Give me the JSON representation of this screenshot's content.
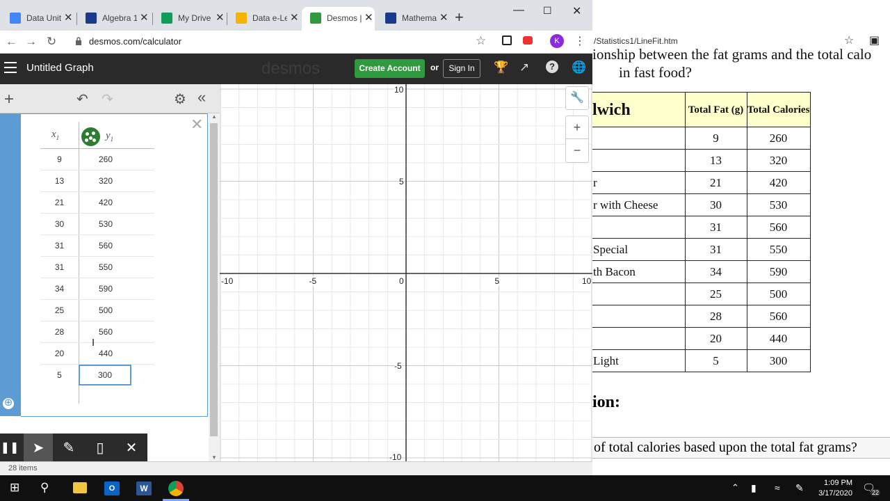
{
  "chrome": {
    "tabs": [
      {
        "label": "Data Unit",
        "color": "#4285f4"
      },
      {
        "label": "Algebra 1",
        "color": "#1b3a8c"
      },
      {
        "label": "My Drive",
        "color": "#0f9d58"
      },
      {
        "label": "Data e-Le",
        "color": "#f4b400"
      },
      {
        "label": "Desmos |",
        "color": "#2f9a3e"
      },
      {
        "label": "Mathema",
        "color": "#1b3a8c"
      }
    ],
    "url": "desmos.com/calculator",
    "avatar_letter": "K"
  },
  "desmos": {
    "graph_title": "Untitled Graph",
    "logo": "desmos",
    "create_account": "Create Account",
    "or": "or",
    "sign_in": "Sign In",
    "table": {
      "x_header": "x",
      "x_sub": "1",
      "y_header": "y",
      "y_sub": "1",
      "x": [
        "9",
        "13",
        "21",
        "30",
        "31",
        "31",
        "34",
        "25",
        "28",
        "20",
        "5"
      ],
      "y": [
        "260",
        "320",
        "420",
        "530",
        "560",
        "550",
        "590",
        "500",
        "560",
        "440",
        "300"
      ]
    },
    "axis": {
      "x_ticks": [
        "-10",
        "-5",
        "0",
        "5",
        "10"
      ],
      "y_ticks": [
        "10",
        "5",
        "-5",
        "-10"
      ]
    }
  },
  "status_text": "28 items",
  "background_doc": {
    "url": "/Statistics1/LineFit.htm",
    "question_line1": "ionship between the fat grams and the total calo",
    "question_line2": "in fast food?",
    "headers": {
      "name": "lwich",
      "fat": "Total Fat (g)",
      "cal": "Total Calories"
    },
    "rows": [
      {
        "name": "",
        "fat": "9",
        "cal": "260"
      },
      {
        "name": "",
        "fat": "13",
        "cal": "320"
      },
      {
        "name": "r",
        "fat": "21",
        "cal": "420"
      },
      {
        "name": "r with Cheese",
        "fat": "30",
        "cal": "530"
      },
      {
        "name": "",
        "fat": "31",
        "cal": "560"
      },
      {
        "name": "Special",
        "fat": "31",
        "cal": "550"
      },
      {
        "name": "th Bacon",
        "fat": "34",
        "cal": "590"
      },
      {
        "name": "",
        "fat": "25",
        "cal": "500"
      },
      {
        "name": "",
        "fat": "28",
        "cal": "560"
      },
      {
        "name": "",
        "fat": "20",
        "cal": "440"
      },
      {
        "name": " Light",
        "fat": "5",
        "cal": "300"
      }
    ],
    "section_heading": "ion:",
    "bottom_question": "of total calories based upon the total fat grams?"
  },
  "taskbar": {
    "time": "1:09 PM",
    "date": "3/17/2020",
    "notifications": "22"
  }
}
